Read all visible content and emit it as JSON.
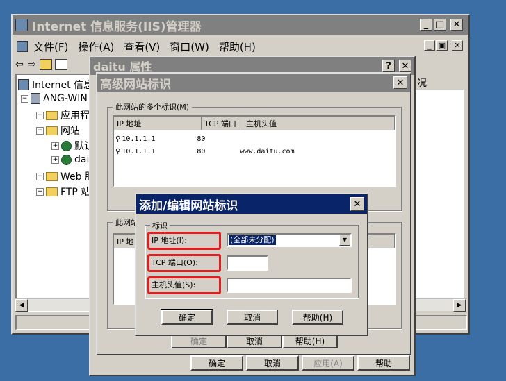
{
  "iis": {
    "title": "Internet 信息服务(IIS)管理器",
    "menu": [
      "文件(F)",
      "操作(A)",
      "查看(V)",
      "窗口(W)",
      "帮助(H)"
    ],
    "tree": {
      "root": "Internet 信息",
      "server": "ANG-WIN",
      "app_pools": "应用程",
      "websites": "网站",
      "site_default": "默认",
      "site_daitu": "dai",
      "web_ext": "Web 服",
      "ftp": "FTP 站"
    },
    "right_header": "况"
  },
  "props": {
    "title": "daitu 属性",
    "bottom_buttons": {
      "ok": "确定",
      "cancel": "取消",
      "apply": "应用(A)",
      "help": "帮助"
    }
  },
  "advanced": {
    "title": "高级网站标识",
    "group1_label": "此网站的多个标识(M)",
    "columns": [
      "IP 地址",
      "TCP 端口",
      "主机头值"
    ],
    "rows": [
      {
        "ip": "10.1.1.1",
        "port": "80",
        "host": ""
      },
      {
        "ip": "10.1.1.1",
        "port": "80",
        "host": "www.daitu.com"
      }
    ],
    "group2_label": "此网站",
    "group2_col": "IP 地",
    "buttons": {
      "ok": "确定",
      "cancel": "取消",
      "help": "帮助(H)"
    }
  },
  "addedit": {
    "title": "添加/编辑网站标识",
    "group_label": "标识",
    "ip_label": "IP 地址(I):",
    "ip_value": "(全部未分配)",
    "port_label": "TCP 端口(O):",
    "port_value": "",
    "host_label": "主机头值(S):",
    "host_value": "",
    "buttons": {
      "ok": "确定",
      "cancel": "取消",
      "help": "帮助(H)"
    }
  },
  "colors": {
    "desktop": "#3a6ea5",
    "active_title": "#0a246a",
    "highlight_box": "#e02020"
  }
}
